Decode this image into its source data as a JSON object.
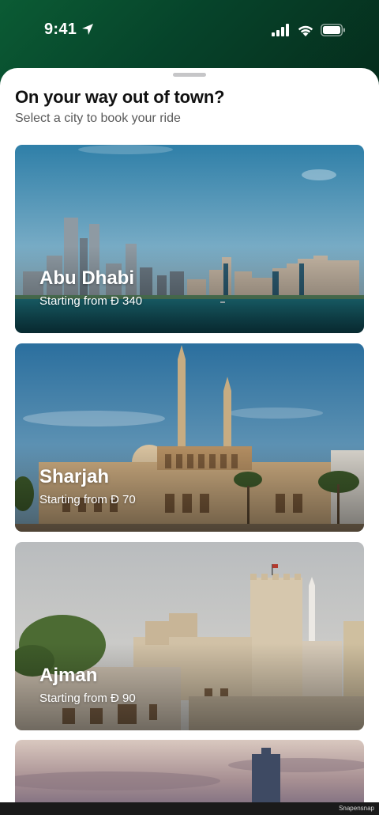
{
  "status_bar": {
    "time": "9:41"
  },
  "sheet": {
    "title": "On your way out of town?",
    "subtitle": "Select a city to book your ride"
  },
  "cities": [
    {
      "name": "Abu Dhabi",
      "price_text": "Starting from Đ 340"
    },
    {
      "name": "Sharjah",
      "price_text": "Starting from Đ 70"
    },
    {
      "name": "Ajman",
      "price_text": "Starting from Đ 90"
    }
  ],
  "watermark": "Snapensnap",
  "colors": {
    "header_green": "#0b5b34",
    "sheet_bg": "#ffffff",
    "title_text": "#111111",
    "subtitle_text": "#5a5a5a"
  },
  "icons": [
    "location-arrow-icon",
    "signal-icon",
    "wifi-icon",
    "battery-icon"
  ]
}
